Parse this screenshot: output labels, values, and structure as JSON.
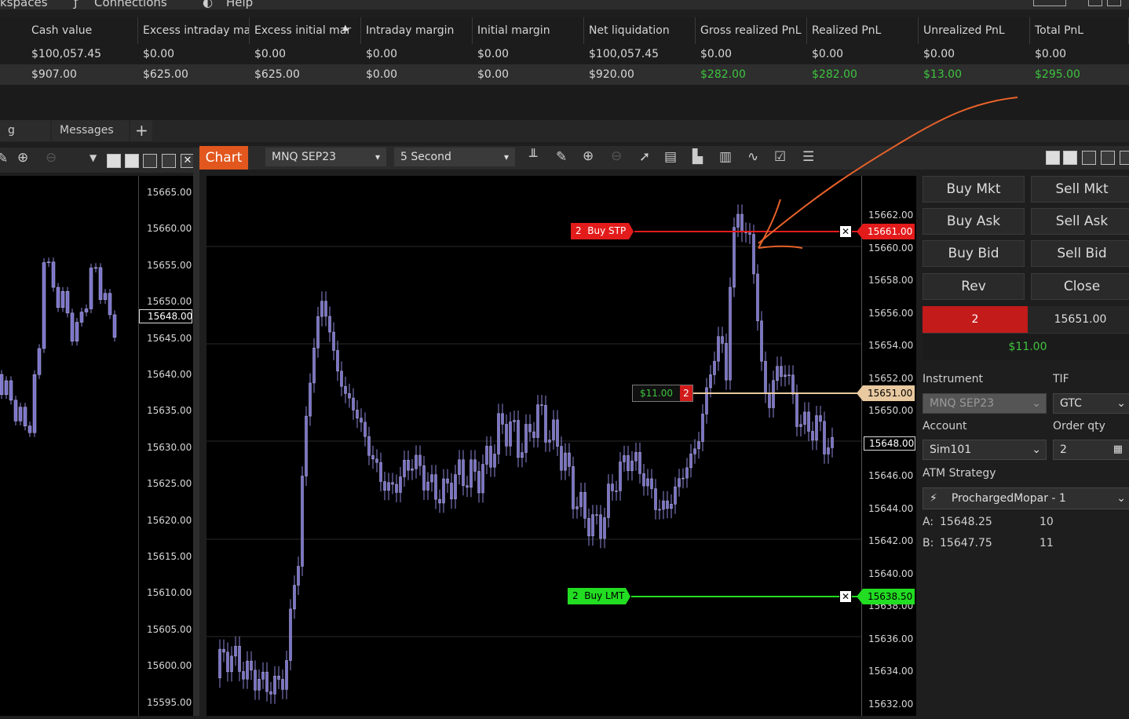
{
  "menu": {
    "workspaces": "kspaces",
    "connections": "Connections",
    "help": "Help"
  },
  "grid": {
    "columns": [
      "Cash value",
      "Excess intraday mar",
      "Excess initial mar",
      "Intraday margin",
      "Initial margin",
      "Net liquidation",
      "Gross realized PnL",
      "Realized PnL",
      "Unrealized PnL",
      "Total PnL"
    ],
    "sort_indicator": "▲",
    "rows": [
      [
        "$100,057.45",
        "$0.00",
        "$0.00",
        "$0.00",
        "$0.00",
        "$100,057.45",
        "$0.00",
        "$0.00",
        "$0.00",
        "$0.00"
      ],
      [
        "$907.00",
        "$625.00",
        "$625.00",
        "$0.00",
        "$0.00",
        "$920.00",
        "$282.00",
        "$282.00",
        "$13.00",
        "$295.00"
      ]
    ]
  },
  "tabs": {
    "first": "g",
    "messages": "Messages",
    "add": "+"
  },
  "chart": {
    "label": "Chart",
    "instrument": "MNQ SEP23",
    "interval": "5 Second",
    "axis_ticks": [
      "15662.00",
      "15660.00",
      "15658.00",
      "15656.00",
      "15654.00",
      "15652.00",
      "15650.00",
      "15648.00",
      "15646.00",
      "15644.00",
      "15642.00",
      "15640.00",
      "15638.00",
      "15636.00",
      "15634.00",
      "15632.00"
    ],
    "last_price": "15648.00",
    "orders": {
      "buy_stp": {
        "label": "2  Buy STP",
        "price": "15661.00"
      },
      "position": {
        "pnl": "$11.00",
        "qty": "2",
        "price": "15651.00"
      },
      "buy_lmt": {
        "label": "2  Buy LMT",
        "price": "15638.50"
      }
    }
  },
  "left_chart": {
    "axis_ticks": [
      "15665.00",
      "15660.00",
      "15655.00",
      "15650.00",
      "15645.00",
      "15640.00",
      "15635.00",
      "15630.00",
      "15625.00",
      "15620.00",
      "15615.00",
      "15610.00",
      "15605.00",
      "15600.00",
      "15595.00"
    ],
    "last_price": "15648.00"
  },
  "panel": {
    "buttons": [
      "Buy Mkt",
      "Sell Mkt",
      "Buy Ask",
      "Sell Ask",
      "Buy Bid",
      "Sell Bid",
      "Rev",
      "Close"
    ],
    "position_qty": "2",
    "position_price": "15651.00",
    "position_pnl": "$11.00",
    "instrument_label": "Instrument",
    "instrument_value": "MNQ SEP23",
    "tif_label": "TIF",
    "tif_value": "GTC",
    "account_label": "Account",
    "account_value": "Sim101",
    "qty_label": "Order qty",
    "qty_value": "2",
    "atm_label": "ATM Strategy",
    "atm_value": "ProchargedMopar - 1",
    "ask_label": "A:",
    "ask_price": "15648.25",
    "ask_size": "10",
    "bid_label": "B:",
    "bid_price": "15647.75",
    "bid_size": "11"
  },
  "colors": {
    "accent": "#e2571e",
    "profit": "#3ec43e",
    "stop": "#e31b1b",
    "limit": "#22dd22",
    "position_line": "#e8c9a0",
    "candle": "#7b74c8",
    "annotation": "#e8622a"
  }
}
